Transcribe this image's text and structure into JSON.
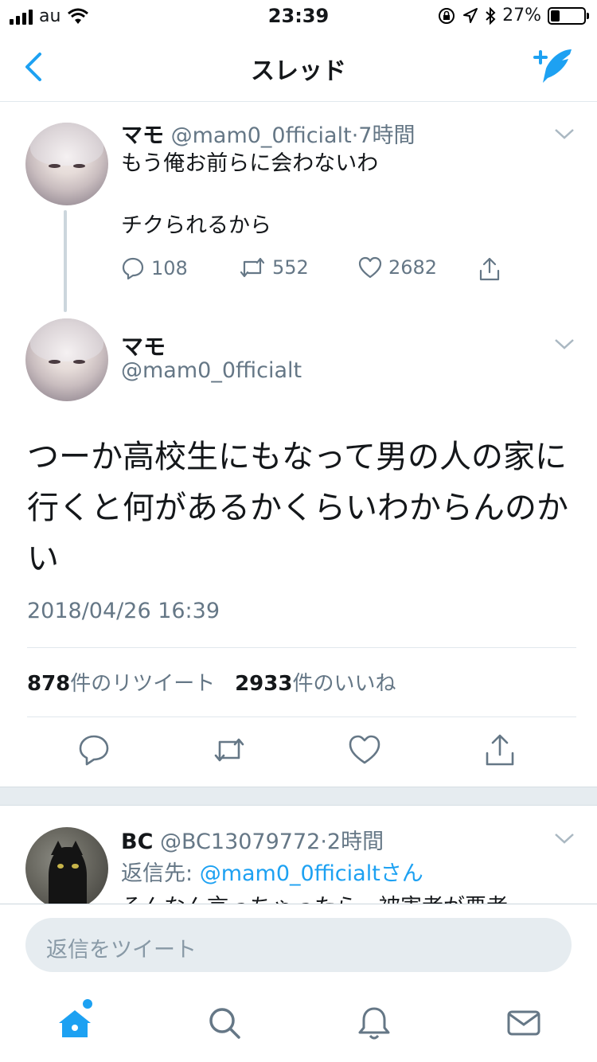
{
  "status_bar": {
    "carrier": "au",
    "time": "23:39",
    "battery_percent_label": "27%",
    "battery_level": 0.27
  },
  "nav": {
    "title": "スレッド",
    "back_icon": "chevron-left-icon",
    "compose_icon": "compose-tweet-icon"
  },
  "tweets": [
    {
      "name": "マモ",
      "handle": "@mam0_0fficialt",
      "time": "7時間",
      "lines": [
        "もう俺お前らに会わないわ",
        "チクられるから"
      ],
      "replies": "108",
      "retweets": "552",
      "likes": "2682"
    }
  ],
  "main_tweet": {
    "name": "マモ",
    "handle": "@mam0_0fficialt",
    "text": "つーか高校生にもなって男の人の家に行くと何があるかくらいわからんのかい",
    "date": "2018/04/26 16:39",
    "retweet_count": "878",
    "retweet_label": "件のリツイート",
    "like_count": "2933",
    "like_label": "件のいいね"
  },
  "reply": {
    "name": "BC",
    "handle": "@BC13079772",
    "time": "2時間",
    "reply_to_label": "返信先:",
    "reply_to_handle": "@mam0_0fficialtさん",
    "text": "そんなん言っちゃったら、被害者が悪者"
  },
  "composer": {
    "placeholder": "返信をツイート"
  },
  "tabs": [
    {
      "name": "home",
      "icon": "home-icon",
      "active": true
    },
    {
      "name": "search",
      "icon": "search-icon",
      "active": false
    },
    {
      "name": "notifications",
      "icon": "bell-icon",
      "active": false
    },
    {
      "name": "messages",
      "icon": "envelope-icon",
      "active": false
    }
  ],
  "colors": {
    "accent": "#1da1f2",
    "muted": "#657786",
    "text": "#14171a",
    "divider": "#e1e8ed"
  }
}
